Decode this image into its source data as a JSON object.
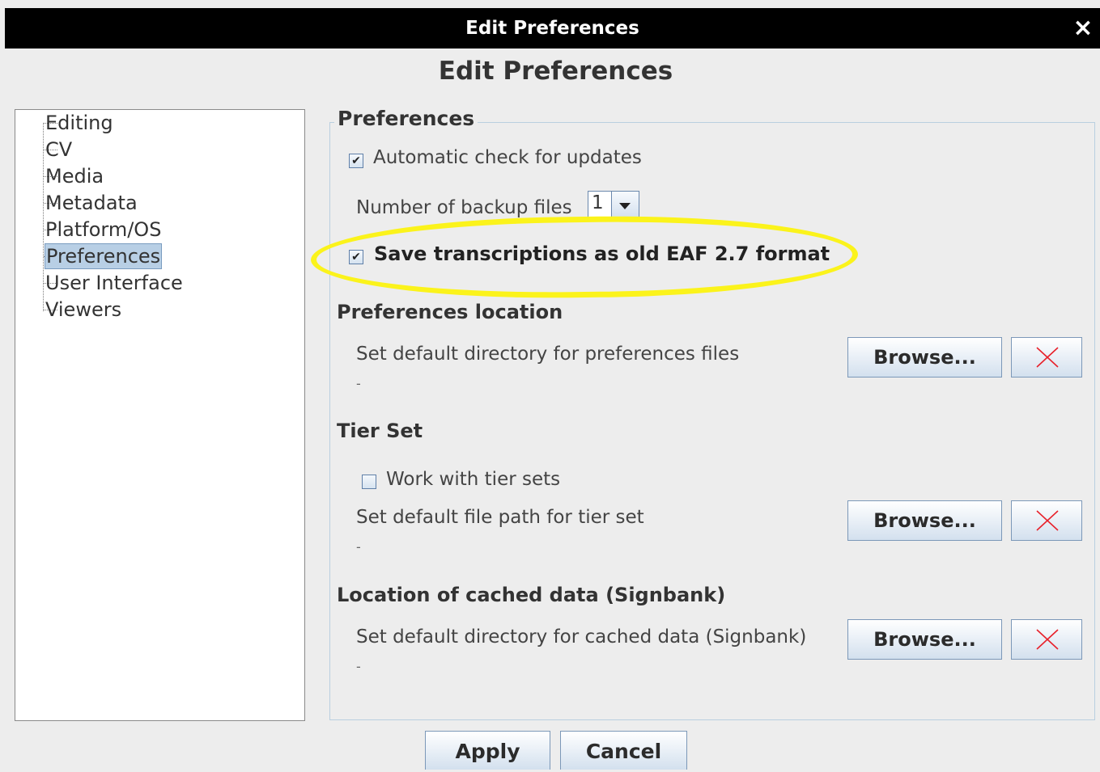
{
  "window": {
    "title": "Edit Preferences",
    "close_glyph": "×"
  },
  "heading": "Edit Preferences",
  "tree": {
    "items": [
      "Editing",
      "CV",
      "Media",
      "Metadata",
      "Platform/OS",
      "Preferences",
      "User Interface",
      "Viewers"
    ],
    "selected": "Preferences"
  },
  "panel": {
    "legend": "Preferences",
    "auto_update": {
      "label": "Automatic check for updates",
      "checked": true
    },
    "backup": {
      "label": "Number of backup files",
      "value": "1"
    },
    "save_old_format": {
      "label": "Save transcriptions as old EAF 2.7 format",
      "checked": true
    },
    "pref_location": {
      "title": "Preferences location",
      "label": "Set default directory for preferences files",
      "value": "-",
      "browse": "Browse..."
    },
    "tier_set": {
      "title": "Tier Set",
      "work_label": "Work with tier sets",
      "work_checked": false,
      "label": "Set default file path for tier set",
      "value": "-",
      "browse": "Browse..."
    },
    "cache_location": {
      "title": "Location of cached data (Signbank)",
      "label": "Set default directory for cached data (Signbank)",
      "value": "-",
      "browse": "Browse..."
    }
  },
  "buttons": {
    "apply": "Apply",
    "cancel": "Cancel"
  },
  "colors": {
    "highlight": "#fbf31b",
    "clear_x": "#e8202a",
    "selection": "#b8cfe5"
  },
  "icons": {
    "check": "✔",
    "clear": "close-x-icon",
    "dropdown": "chevron-down-icon"
  }
}
